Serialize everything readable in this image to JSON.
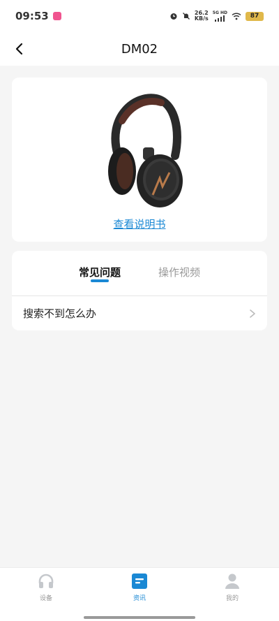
{
  "status_bar": {
    "time": "09:53",
    "speed_value": "26.2",
    "speed_unit": "KB/s",
    "signal_label": "5G HD",
    "battery": "87"
  },
  "header": {
    "title": "DM02"
  },
  "product": {
    "manual_link": "查看说明书"
  },
  "faq": {
    "tabs": [
      {
        "label": "常见问题",
        "active": true
      },
      {
        "label": "操作视频",
        "active": false
      }
    ],
    "items": [
      {
        "text": "搜索不到怎么办"
      }
    ]
  },
  "bottom_nav": {
    "items": [
      {
        "label": "设备",
        "icon": "headphones-icon",
        "active": false
      },
      {
        "label": "资讯",
        "icon": "news-icon",
        "active": true
      },
      {
        "label": "我的",
        "icon": "person-icon",
        "active": false
      }
    ]
  },
  "colors": {
    "accent": "#1a88d4",
    "background": "#f5f5f5",
    "battery": "#e0b84a"
  }
}
